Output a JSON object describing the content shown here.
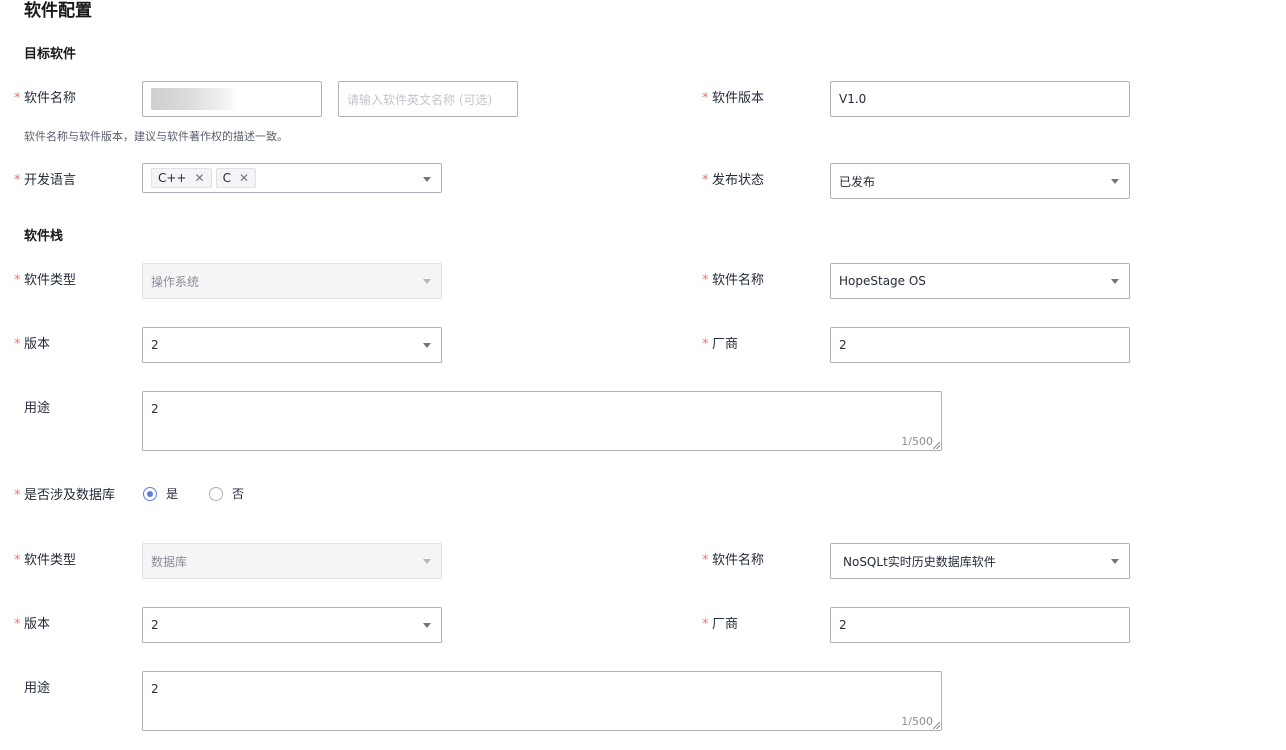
{
  "page_title": "软件配置",
  "required_mark": "*",
  "target": {
    "section_title": "目标软件",
    "name_label": "软件名称",
    "name_en_placeholder": "请输入软件英文名称 (可选)",
    "version_label": "软件版本",
    "version_value": "V1.0",
    "hint": "软件名称与软件版本，建议与软件著作权的描述一致。",
    "lang_label": "开发语言",
    "lang_tags": [
      "C++",
      "C"
    ],
    "tag_remove_glyph": "✕",
    "status_label": "发布状态",
    "status_value": "已发布"
  },
  "stack": {
    "section_title": "软件栈",
    "os": {
      "type_label": "软件类型",
      "type_value": "操作系统",
      "name_label": "软件名称",
      "name_value": "HopeStage OS",
      "version_label": "版本",
      "version_value": "2",
      "vendor_label": "厂商",
      "vendor_value": "2",
      "usage_label": "用途",
      "usage_value": "2",
      "usage_counter": "1/500"
    },
    "db_question": {
      "label": "是否涉及数据库",
      "yes_label": "是",
      "no_label": "否",
      "selected": "yes"
    },
    "db": {
      "type_label": "软件类型",
      "type_value": "数据库",
      "name_label": "软件名称",
      "name_value": "NoSQLt实时历史数据库软件",
      "version_label": "版本",
      "version_value": "2",
      "vendor_label": "厂商",
      "vendor_value": "2",
      "usage_label": "用途",
      "usage_value": "2",
      "usage_counter": "1/500"
    }
  },
  "colors": {
    "accent": "#5e7ce0",
    "required": "#f66f6a",
    "border": "#adb0b8",
    "disabled_bg": "#f5f5f6"
  },
  "icons": {
    "select_caret": "chevron-down-icon",
    "tag_remove": "close-icon"
  }
}
